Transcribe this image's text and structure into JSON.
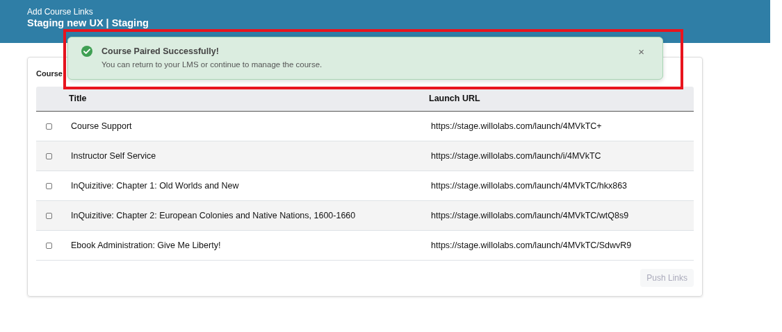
{
  "header": {
    "subtitle": "Add Course Links",
    "title": "Staging new UX | Staging"
  },
  "card": {
    "title": "Course",
    "table": {
      "columns": [
        "Title",
        "Launch URL"
      ],
      "rows": [
        {
          "checked": false,
          "title": "Course Support",
          "url": "https://stage.willolabs.com/launch/4MVkTC+"
        },
        {
          "checked": false,
          "title": "Instructor Self Service",
          "url": "https://stage.willolabs.com/launch/i/4MVkTC"
        },
        {
          "checked": false,
          "title": "InQuizitive: Chapter 1: Old Worlds and New",
          "url": "https://stage.willolabs.com/launch/4MVkTC/hkx863"
        },
        {
          "checked": false,
          "title": "InQuizitive: Chapter 2: European Colonies and Native Nations, 1600-1660",
          "url": "https://stage.willolabs.com/launch/4MVkTC/wtQ8s9"
        },
        {
          "checked": false,
          "title": "Ebook Administration: Give Me Liberty!",
          "url": "https://stage.willolabs.com/launch/4MVkTC/SdwvR9"
        }
      ]
    },
    "button": {
      "label": "Push Links",
      "disabled": true
    }
  },
  "toast": {
    "title": "Course Paired Successfully!",
    "message": "You can return to your LMS or continue to manage the course.",
    "close": "×"
  }
}
